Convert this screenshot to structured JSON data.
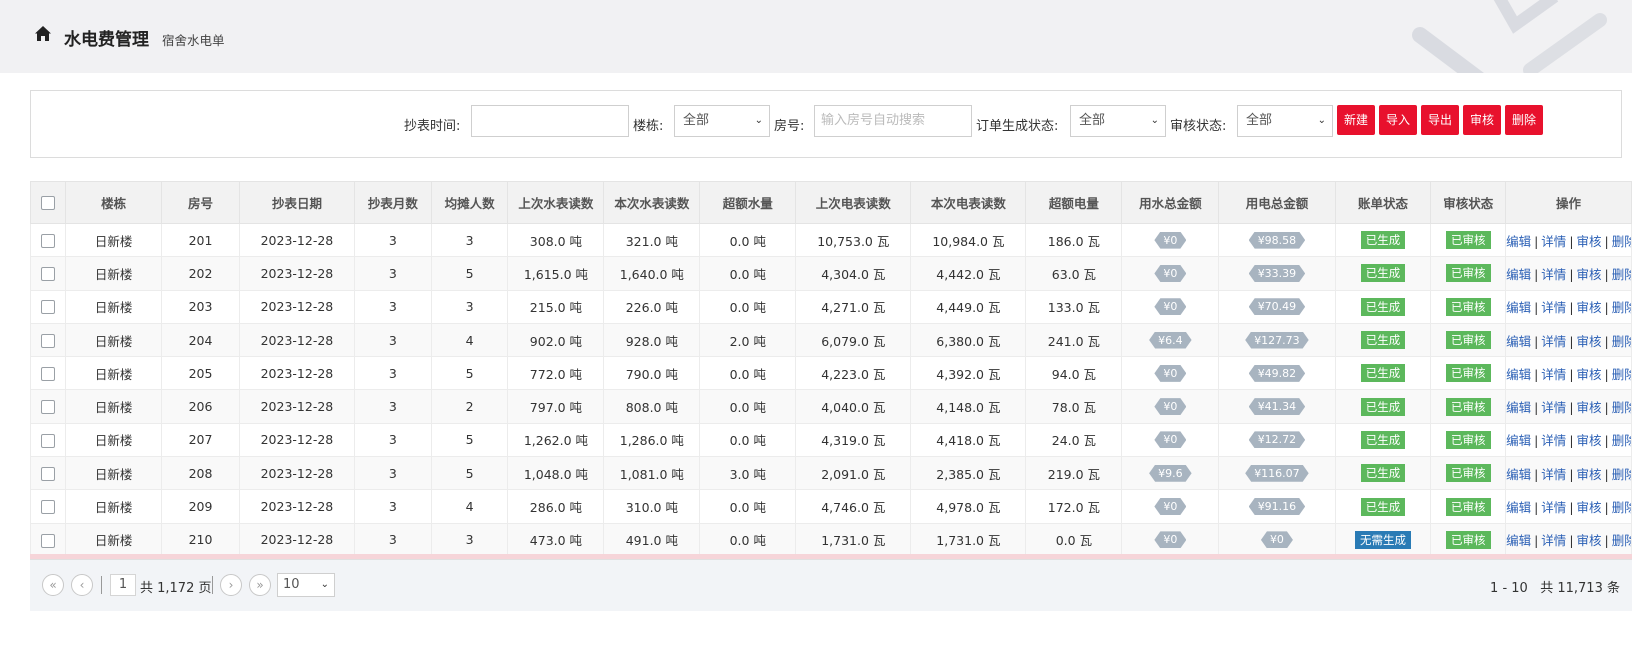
{
  "header": {
    "title": "水电费管理",
    "subtitle": "宿舍水电单"
  },
  "search": {
    "reading_time_label": "抄表时间:",
    "reading_time_value": "",
    "building_label": "楼栋:",
    "building_value": "全部",
    "room_label": "房号:",
    "room_placeholder": "输入房号自动搜索",
    "order_status_label": "订单生成状态:",
    "order_status_value": "全部",
    "audit_status_label": "审核状态:",
    "audit_status_value": "全部",
    "buttons": {
      "new": "新建",
      "import": "导入",
      "export": "导出",
      "audit": "审核",
      "delete": "删除"
    }
  },
  "table": {
    "headers": [
      "楼栋",
      "房号",
      "抄表日期",
      "抄表月数",
      "均摊人数",
      "上次水表读数",
      "本次水表读数",
      "超额水量",
      "上次电表读数",
      "本次电表读数",
      "超额电量",
      "用水总金额",
      "用电总金额",
      "账单状态",
      "审核状态",
      "操作"
    ],
    "ops": {
      "edit": "编辑",
      "detail": "详情",
      "audit": "审核",
      "delete": "删除",
      "sep": "|"
    },
    "rows": [
      {
        "building": "日新楼",
        "room": "201",
        "date": "2023-12-28",
        "months": "3",
        "people": "3",
        "w_prev": "308.0 吨",
        "w_cur": "321.0 吨",
        "w_over": "0.0 吨",
        "e_prev": "10,753.0 瓦",
        "e_cur": "10,984.0 瓦",
        "e_over": "186.0 瓦",
        "w_amt": "¥0",
        "e_amt": "¥98.58",
        "bill": "已生成",
        "audit": "已审核"
      },
      {
        "building": "日新楼",
        "room": "202",
        "date": "2023-12-28",
        "months": "3",
        "people": "5",
        "w_prev": "1,615.0 吨",
        "w_cur": "1,640.0 吨",
        "w_over": "0.0 吨",
        "e_prev": "4,304.0 瓦",
        "e_cur": "4,442.0 瓦",
        "e_over": "63.0 瓦",
        "w_amt": "¥0",
        "e_amt": "¥33.39",
        "bill": "已生成",
        "audit": "已审核"
      },
      {
        "building": "日新楼",
        "room": "203",
        "date": "2023-12-28",
        "months": "3",
        "people": "3",
        "w_prev": "215.0 吨",
        "w_cur": "226.0 吨",
        "w_over": "0.0 吨",
        "e_prev": "4,271.0 瓦",
        "e_cur": "4,449.0 瓦",
        "e_over": "133.0 瓦",
        "w_amt": "¥0",
        "e_amt": "¥70.49",
        "bill": "已生成",
        "audit": "已审核"
      },
      {
        "building": "日新楼",
        "room": "204",
        "date": "2023-12-28",
        "months": "3",
        "people": "4",
        "w_prev": "902.0 吨",
        "w_cur": "928.0 吨",
        "w_over": "2.0 吨",
        "e_prev": "6,079.0 瓦",
        "e_cur": "6,380.0 瓦",
        "e_over": "241.0 瓦",
        "w_amt": "¥6.4",
        "e_amt": "¥127.73",
        "bill": "已生成",
        "audit": "已审核"
      },
      {
        "building": "日新楼",
        "room": "205",
        "date": "2023-12-28",
        "months": "3",
        "people": "5",
        "w_prev": "772.0 吨",
        "w_cur": "790.0 吨",
        "w_over": "0.0 吨",
        "e_prev": "4,223.0 瓦",
        "e_cur": "4,392.0 瓦",
        "e_over": "94.0 瓦",
        "w_amt": "¥0",
        "e_amt": "¥49.82",
        "bill": "已生成",
        "audit": "已审核"
      },
      {
        "building": "日新楼",
        "room": "206",
        "date": "2023-12-28",
        "months": "3",
        "people": "2",
        "w_prev": "797.0 吨",
        "w_cur": "808.0 吨",
        "w_over": "0.0 吨",
        "e_prev": "4,040.0 瓦",
        "e_cur": "4,148.0 瓦",
        "e_over": "78.0 瓦",
        "w_amt": "¥0",
        "e_amt": "¥41.34",
        "bill": "已生成",
        "audit": "已审核"
      },
      {
        "building": "日新楼",
        "room": "207",
        "date": "2023-12-28",
        "months": "3",
        "people": "5",
        "w_prev": "1,262.0 吨",
        "w_cur": "1,286.0 吨",
        "w_over": "0.0 吨",
        "e_prev": "4,319.0 瓦",
        "e_cur": "4,418.0 瓦",
        "e_over": "24.0 瓦",
        "w_amt": "¥0",
        "e_amt": "¥12.72",
        "bill": "已生成",
        "audit": "已审核"
      },
      {
        "building": "日新楼",
        "room": "208",
        "date": "2023-12-28",
        "months": "3",
        "people": "5",
        "w_prev": "1,048.0 吨",
        "w_cur": "1,081.0 吨",
        "w_over": "3.0 吨",
        "e_prev": "2,091.0 瓦",
        "e_cur": "2,385.0 瓦",
        "e_over": "219.0 瓦",
        "w_amt": "¥9.6",
        "e_amt": "¥116.07",
        "bill": "已生成",
        "audit": "已审核"
      },
      {
        "building": "日新楼",
        "room": "209",
        "date": "2023-12-28",
        "months": "3",
        "people": "4",
        "w_prev": "286.0 吨",
        "w_cur": "310.0 吨",
        "w_over": "0.0 吨",
        "e_prev": "4,746.0 瓦",
        "e_cur": "4,978.0 瓦",
        "e_over": "172.0 瓦",
        "w_amt": "¥0",
        "e_amt": "¥91.16",
        "bill": "已生成",
        "audit": "已审核"
      },
      {
        "building": "日新楼",
        "room": "210",
        "date": "2023-12-28",
        "months": "3",
        "people": "3",
        "w_prev": "473.0 吨",
        "w_cur": "491.0 吨",
        "w_over": "0.0 吨",
        "e_prev": "1,731.0 瓦",
        "e_cur": "1,731.0 瓦",
        "e_over": "0.0 瓦",
        "w_amt": "¥0",
        "e_amt": "¥0",
        "bill": "无需生成",
        "audit": "已审核"
      }
    ]
  },
  "pager": {
    "first_icon": "double-chevron-left-icon",
    "prev_icon": "chevron-left-icon",
    "next_icon": "chevron-right-icon",
    "last_icon": "double-chevron-right-icon",
    "current_page": "1",
    "total_pages_text": "共 1,172 页",
    "page_size": "10",
    "range_text": "1 - 10",
    "total_text": "共 11,713 条"
  },
  "colors": {
    "danger_button": "#e8112d",
    "status_green": "#5cb85c",
    "status_blue": "#2a7bb5",
    "amount_tag": "#a8b4c0",
    "link": "#2a5fb5"
  }
}
